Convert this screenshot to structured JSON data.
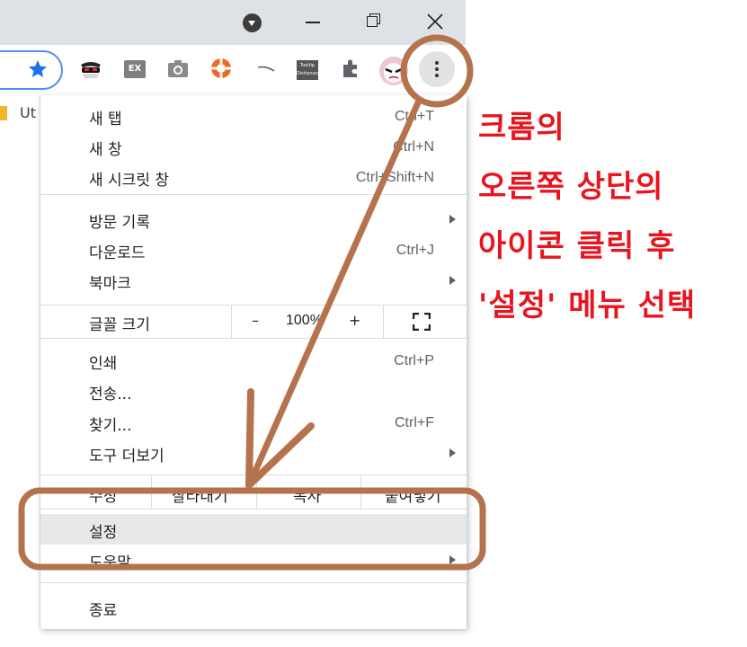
{
  "bookmark_bar": {
    "folder_label": "Ut"
  },
  "extensions": {
    "ex_label": "EX",
    "tooltip_label": "Tooltip Dictionary"
  },
  "menu": {
    "items_top": [
      {
        "label": "새 탭",
        "shortcut": "Ctrl+T"
      },
      {
        "label": "새 창",
        "shortcut": "Ctrl+N"
      },
      {
        "label": "새 시크릿 창",
        "shortcut": "Ctrl+Shift+N"
      }
    ],
    "items_mid": [
      {
        "label": "방문 기록",
        "shortcut": ""
      },
      {
        "label": "다운로드",
        "shortcut": "Ctrl+J"
      },
      {
        "label": "북마크",
        "shortcut": ""
      }
    ],
    "zoom": {
      "label": "글꼴 크기",
      "minus": "–",
      "value": "100%",
      "plus": "+"
    },
    "items_tools": [
      {
        "label": "인쇄",
        "shortcut": "Ctrl+P"
      },
      {
        "label": "전송...",
        "shortcut": ""
      },
      {
        "label": "찾기...",
        "shortcut": "Ctrl+F"
      },
      {
        "label": "도구 더보기",
        "shortcut": ""
      }
    ],
    "edit": {
      "label": "수정",
      "cut": "잘라내기",
      "copy": "복사",
      "paste": "붙여넣기"
    },
    "settings": "설정",
    "help": "도움말",
    "exit": "종료"
  },
  "annotation": {
    "lines": [
      "크롬의",
      "오른쪽 상단의",
      "아이콘 클릭 후",
      "'설정' 메뉴 선택"
    ],
    "text_color": "#e8141e",
    "marker_color": "#b5734d"
  },
  "colors": {
    "titlebar": "#dee1e6",
    "omnibox_border": "#4d90f0",
    "star": "#1a73e8"
  }
}
